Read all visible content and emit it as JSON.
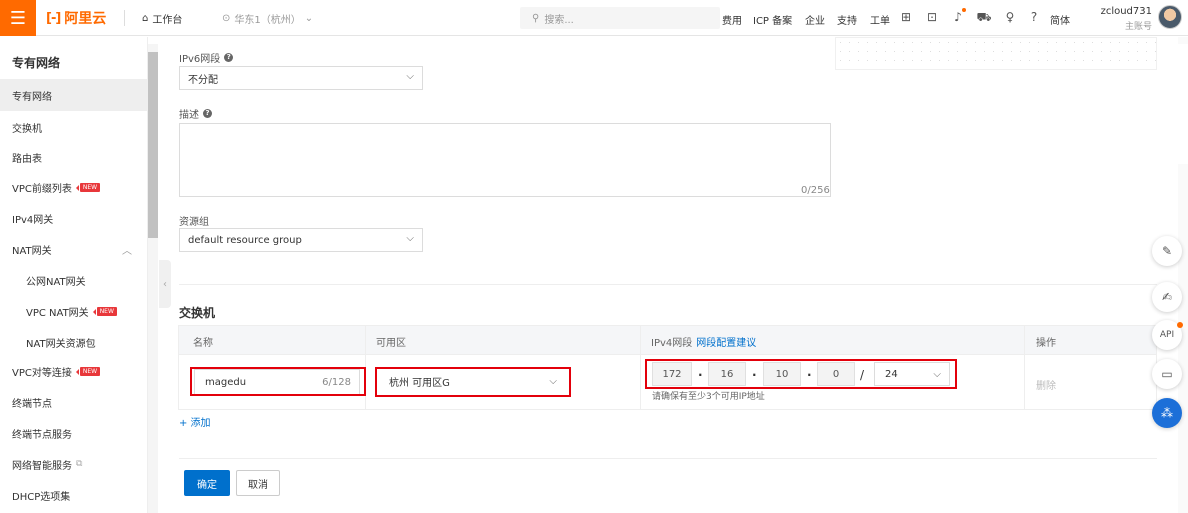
{
  "topbar": {
    "logo_mark": "[-]",
    "logo_text": "阿里云",
    "workbench": "工作台",
    "region": "华东1（杭州）",
    "search_placeholder": "搜索...",
    "nav": [
      "费用",
      "ICP 备案",
      "企业",
      "支持",
      "工单"
    ],
    "lang": "简体",
    "username": "zcloud731",
    "account_type": "主账号"
  },
  "sidebar": {
    "title": "专有网络",
    "items": [
      {
        "label": "专有网络"
      },
      {
        "label": "交换机"
      },
      {
        "label": "路由表"
      },
      {
        "label": "VPC前缀列表",
        "badge": "NEW"
      },
      {
        "label": "IPv4网关"
      },
      {
        "label": "NAT网关"
      },
      {
        "label": "公网NAT网关"
      },
      {
        "label": "VPC NAT网关",
        "badge": "NEW"
      },
      {
        "label": "NAT网关资源包"
      },
      {
        "label": "VPC对等连接",
        "badge": "NEW"
      },
      {
        "label": "终端节点"
      },
      {
        "label": "终端节点服务"
      },
      {
        "label": "网络智能服务"
      },
      {
        "label": "DHCP选项集"
      }
    ]
  },
  "form": {
    "ipv6_label": "IPv6网段",
    "ipv6_value": "不分配",
    "desc_label": "描述",
    "desc_counter": "0/256",
    "rg_label": "资源组",
    "rg_value": "default resource group",
    "switch_section": "交换机",
    "table_headers": {
      "name": "名称",
      "zone": "可用区",
      "ipv4": "IPv4网段",
      "ipv4_link": "网段配置建议",
      "op": "操作"
    },
    "row": {
      "name": "magedu",
      "name_counter": "6/128",
      "zone": "杭州 可用区G",
      "ip": [
        "172",
        "16",
        "10",
        "0"
      ],
      "ip_sep": "/",
      "mask": "24",
      "hint": "请确保有至少3个可用IP地址",
      "delete": "删除"
    },
    "add": "+ 添加",
    "confirm": "确定",
    "cancel": "取消"
  },
  "float_buttons": [
    "edit-icon",
    "note-icon",
    "api-icon",
    "chat-icon",
    "apps-icon"
  ],
  "float_api": "API",
  "colors": {
    "brand": "#ff6a00",
    "primary": "#0070cc",
    "highlight": "#e3000b"
  }
}
